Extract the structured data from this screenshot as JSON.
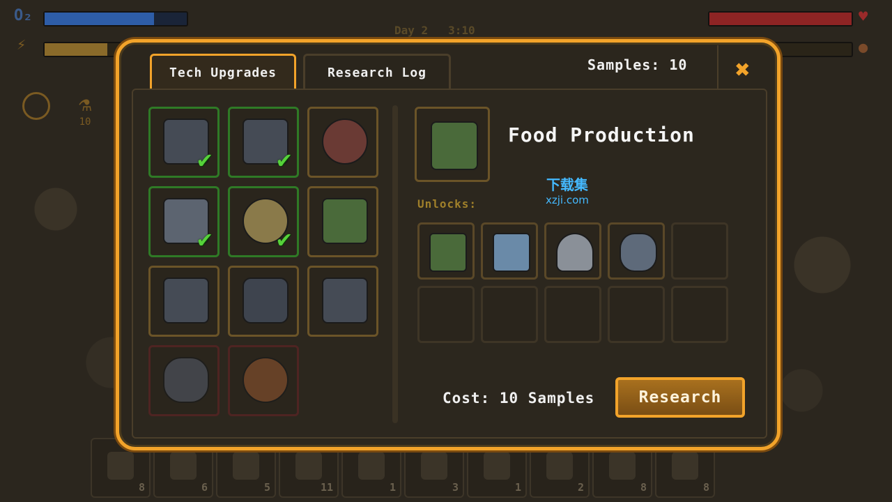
{
  "hud": {
    "oxygen_label": "O₂",
    "oxygen_level": 0.77,
    "energy_level": 0.44,
    "health_level": 1.0,
    "food_level": 0.4,
    "day_label": "Day 2",
    "time_label": "3:10",
    "side_samples_count": "10"
  },
  "toolbar": [
    {
      "icon": "shovel-icon",
      "count": "8"
    },
    {
      "icon": "metal-plate-icon",
      "count": "6"
    },
    {
      "icon": "rock-pile-icon",
      "count": "5"
    },
    {
      "icon": "gravel-icon",
      "count": "11"
    },
    {
      "icon": "circuit-board-icon",
      "count": "1"
    },
    {
      "icon": "gear-icon",
      "count": "3"
    },
    {
      "icon": "plant-icon",
      "count": "1"
    },
    {
      "icon": "metal-bar-icon",
      "count": "2"
    },
    {
      "icon": "stone-icon",
      "count": "8"
    },
    {
      "icon": "crystal-ore-icon",
      "count": "8"
    }
  ],
  "modal": {
    "tabs": [
      {
        "label": "Tech Upgrades",
        "active": true
      },
      {
        "label": "Research Log",
        "active": false
      }
    ],
    "samples_label": "Samples: 10",
    "close_label": "✖",
    "tech_tiles": [
      {
        "name": "storage-chest",
        "state": "done",
        "icon_class": "dark"
      },
      {
        "name": "solar-panel",
        "state": "done",
        "icon_class": "dark"
      },
      {
        "name": "cooling-fan",
        "state": "available",
        "icon_class": "red"
      },
      {
        "name": "container",
        "state": "done",
        "icon_class": ""
      },
      {
        "name": "food-dishes",
        "state": "done",
        "icon_class": "bowl"
      },
      {
        "name": "food-production",
        "state": "available",
        "icon_class": "plant"
      },
      {
        "name": "radio-beacon",
        "state": "available",
        "icon_class": "dark"
      },
      {
        "name": "rover",
        "state": "available",
        "icon_class": "rover"
      },
      {
        "name": "recycler-machine",
        "state": "available",
        "icon_class": "dark"
      },
      {
        "name": "drone",
        "state": "locked",
        "icon_class": "drone"
      },
      {
        "name": "helmet",
        "state": "locked",
        "icon_class": "helmet"
      }
    ],
    "detail": {
      "title": "Food Production",
      "unlocks_label": "Unlocks:",
      "unlocks": [
        {
          "name": "planter-box",
          "icon_class": "plant"
        },
        {
          "name": "water-tank",
          "icon_class": "tank"
        },
        {
          "name": "cooking-dish",
          "icon_class": "dish"
        },
        {
          "name": "water-pump",
          "icon_class": "pump"
        },
        null,
        null,
        null,
        null,
        null,
        null
      ],
      "cost_label": "Cost: 10 Samples",
      "research_button": "Research"
    },
    "watermark": {
      "top": "下载集",
      "bottom": "xzji.com"
    }
  },
  "colors": {
    "accent": "#f2a32a",
    "done_border": "#2f7a26",
    "locked_border": "#5a2424",
    "check": "#56d23a"
  }
}
